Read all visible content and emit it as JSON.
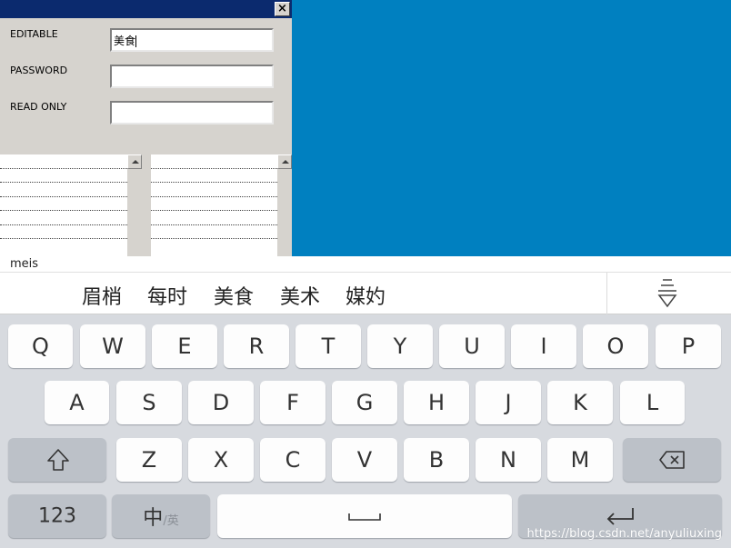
{
  "form": {
    "editable_label": "EDITABLE",
    "editable_value": "美食",
    "password_label": "PASSWORD",
    "password_value": "",
    "readonly_label": "READ ONLY",
    "readonly_value": ""
  },
  "ime": {
    "composition": "meis",
    "candidates": [
      "眉梢",
      "每时",
      "美食",
      "美术",
      "媒妁"
    ]
  },
  "keyboard": {
    "row1": [
      "Q",
      "W",
      "E",
      "R",
      "T",
      "Y",
      "U",
      "I",
      "O",
      "P"
    ],
    "row2": [
      "A",
      "S",
      "D",
      "F",
      "G",
      "H",
      "J",
      "K",
      "L"
    ],
    "row3": [
      "Z",
      "X",
      "C",
      "V",
      "B",
      "N",
      "M"
    ],
    "numbers_label": "123",
    "lang_label_main": "中",
    "lang_label_alt": "/英"
  },
  "watermark": "https://blog.csdn.net/anyuliuxing",
  "colors": {
    "titlebar": "#0b2a6e",
    "dialog_bg": "#d6d3ce",
    "blue_panel": "#0080c0",
    "keyboard_bg": "#d7dadf"
  }
}
